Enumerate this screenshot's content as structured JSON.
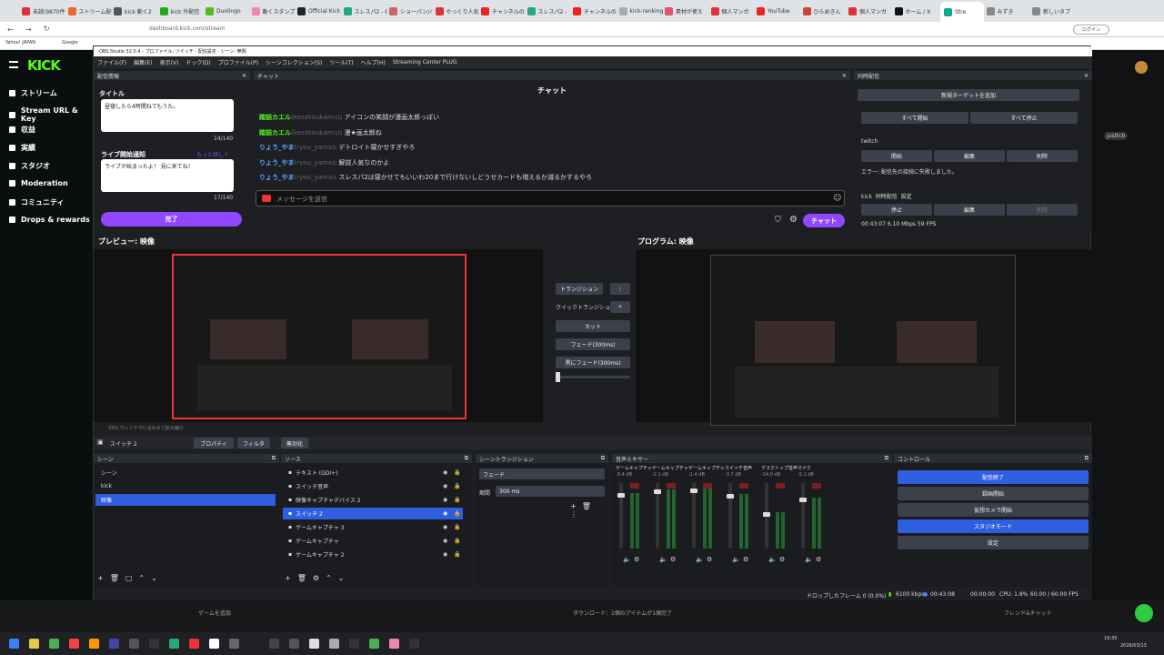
{
  "browser": {
    "tabs": [
      "未読(9870件)",
      "ストリーム配信",
      "kick 動く2",
      "kick 外配信",
      "Duolingo",
      "動くスタンプ",
      "Official Kick",
      "スレスパ2 - G",
      "ショーパン/パ",
      "やっくり人気",
      "チャンネルの",
      "スレスパ2 - ",
      "チャンネルの",
      "kick-ranking",
      "素材が使え",
      "個人マンガ",
      "YouTube",
      "ひらめきん",
      "個人マンガ",
      "ホーム / X",
      "Stre",
      "みずき",
      "新しいタブ"
    ],
    "active_tab": "Stre",
    "url": "dashboard.kick.com/stream",
    "bookmarks": [
      "Yahoo! JAPAN",
      "Google"
    ],
    "login_label": "ログイン"
  },
  "kick": {
    "logo": "KICK",
    "nav": [
      "ストリーム",
      "Stream URL & Key",
      "収益",
      "実績",
      "スタジオ",
      "Moderation",
      "コミュニティ",
      "Drops & rewards"
    ],
    "right_label": "justtcb"
  },
  "obs": {
    "title": "OBS Studio 32.0.4 - プロファイル: ツイッチ - 配信設定 - シーン: 無題",
    "menu": [
      "ファイル(F)",
      "編集(E)",
      "表示(V)",
      "ドック(D)",
      "プロファイル(P)",
      "シーンコレクション(S)",
      "ツール(T)",
      "ヘルプ(H)",
      "Streaming Center PLUG"
    ],
    "stream_info": {
      "header": "配信情報",
      "title_label": "タイトル",
      "title_value": "昼寝したら4時間ねてもうた。",
      "title_count": "14/140",
      "notify_label": "ライブ開始通知",
      "notify_link": "もっと詳しく",
      "notify_value": "ライブが始まったよ！ 見に来てね！",
      "notify_count": "17/140",
      "done_button": "完了"
    },
    "chat": {
      "header": "チャット",
      "title": "チャット",
      "messages": [
        {
          "user": "踏詰カエル",
          "handle": "(kesshoukaeru)",
          "text": "アイコンの笑顔が漫画太郎っぽい"
        },
        {
          "user": "踏詰カエル",
          "handle": "(kesshoukaeru)",
          "text": "漫★画太郎ね"
        },
        {
          "user": "りょう_やま",
          "handle": "(ryou_yama)",
          "text": "デトロイト寝かせすぎやろ"
        },
        {
          "user": "りょう_やま",
          "handle": "(ryou_yama)",
          "text": "解説人気なのかよ"
        },
        {
          "user": "りょう_やま",
          "handle": "(ryou_yama)",
          "text": "スレスパ2は寝かせてもいいわ20まで行けないしどうせカードも増えるか減るかするやろ"
        }
      ],
      "input_placeholder": "メッセージを送信",
      "send_button": "チャット"
    },
    "multistream": {
      "header": "同時配信",
      "new_target": "新規ターゲットを追加",
      "start_all": "すべて開始",
      "stop_all": "すべて停止",
      "twitch_label": "twitch",
      "start": "開始",
      "edit": "編集",
      "delete": "削除",
      "error": "エラー: 配信先の接続に失敗しました。",
      "kick_label": "kick",
      "kick_sync": "同時配信",
      "kick_settings": "設定",
      "stop": "停止",
      "stats": "00:43:07  6.10 Mbps  59 FPS"
    },
    "preview_label": "プレビュー: 映像",
    "program_label": "プログラム: 映像",
    "transitions": {
      "transition": "トランジション",
      "quick": "クイックトランジション",
      "cut": "カット",
      "fade": "フェード(300ms)",
      "black_fade": "黒にフェード(300ms)"
    },
    "zoom_text": "33%  ウィンドウに合わせて拡大縮小",
    "source_bar": {
      "selected": "スイッチ 2",
      "properties": "プロパティ",
      "filters": "フィルタ",
      "deactivate": "無効化"
    },
    "scenes": {
      "header": "シーン",
      "items": [
        "シーン",
        "kick",
        "映像"
      ],
      "selected": "映像"
    },
    "sources": {
      "header": "ソース",
      "items": [
        "テキスト (GDI+)",
        "スイッチ音声",
        "映像キャプチャデバイス 2",
        "スイッチ 2",
        "ゲームキャプチャ 3",
        "ゲームキャプチャ",
        "ゲームキャプチャ 2"
      ],
      "selected": "スイッチ 2"
    },
    "scene_transition": {
      "header": "シーントランジション",
      "type": "フェード",
      "duration_label": "期間",
      "duration": "300 ms"
    },
    "mixer": {
      "header": "音声ミキサー",
      "channels": [
        {
          "name": "ゲームキャプチャ",
          "db": "-3.4 dB",
          "level": 0.85
        },
        {
          "name": "ゲームキャプチャ 2",
          "db": "-2.1 dB",
          "level": 0.9
        },
        {
          "name": "ゲームキャプチャ 3",
          "db": "-1.4 dB",
          "level": 0.92
        },
        {
          "name": "スイッチ音声",
          "db": "-3.7 dB",
          "level": 0.84
        },
        {
          "name": "デスクトップ音声",
          "db": "-14.0 dB",
          "level": 0.55
        },
        {
          "name": "マイク",
          "db": "-5.1 dB",
          "level": 0.78
        }
      ]
    },
    "controls": {
      "header": "コントロール",
      "buttons": [
        "配信終了",
        "録画開始",
        "仮想カメラ開始",
        "スタジオモード",
        "設定"
      ]
    },
    "status": {
      "dropped": "ドロップしたフレーム 0 (0.0%)",
      "kbps": "6100 kbps",
      "live_time": "00:43:08",
      "rec_time": "00:00:00",
      "cpu": "CPU: 1.8%",
      "fps": "60.00 / 60.00 FPS"
    }
  },
  "bottom": {
    "left": "ゲームを追加",
    "center": "ダウンロード：1個のアイテムが1個完了",
    "right": "フレンド&チャット"
  },
  "clock": {
    "time": "19:35",
    "date": "2026/03/13"
  }
}
